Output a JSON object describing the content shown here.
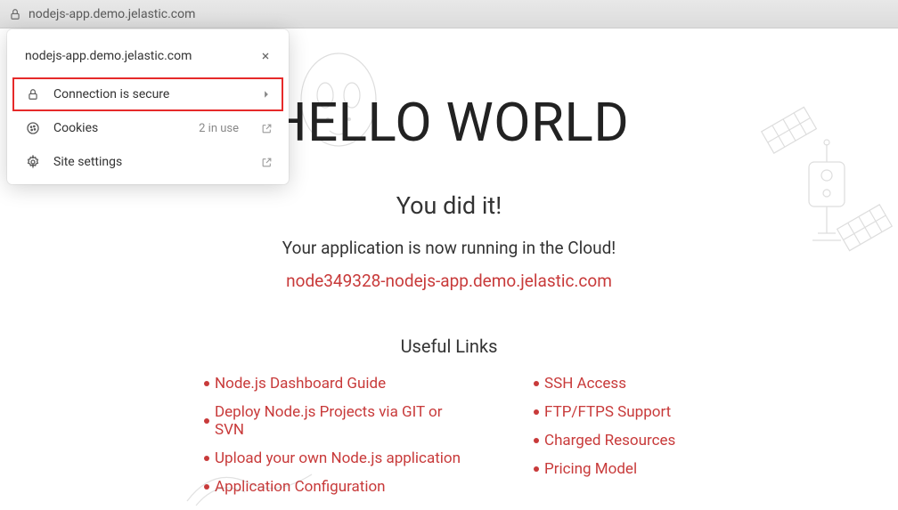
{
  "address_bar": {
    "url": "nodejs-app.demo.jelastic.com"
  },
  "site_info_dropdown": {
    "domain": "nodejs-app.demo.jelastic.com",
    "connection_label": "Connection is secure",
    "cookies_label": "Cookies",
    "cookies_meta": "2 in use",
    "site_settings_label": "Site settings"
  },
  "page": {
    "hello": "HELLO WORLD",
    "you_did_it": "You did it!",
    "running_text": "Your application is now running in the Cloud!",
    "app_url": "node349328-nodejs-app.demo.jelastic.com",
    "useful_links_title": "Useful Links",
    "links_col1": {
      "l1": "Node.js Dashboard Guide",
      "l2": "Deploy Node.js Projects via GIT or SVN",
      "l3": "Upload your own Node.js application",
      "l4": "Application Configuration"
    },
    "links_col2": {
      "l1": "SSH Access",
      "l2": "FTP/FTPS Support",
      "l3": "Charged Resources",
      "l4": "Pricing Model"
    }
  }
}
